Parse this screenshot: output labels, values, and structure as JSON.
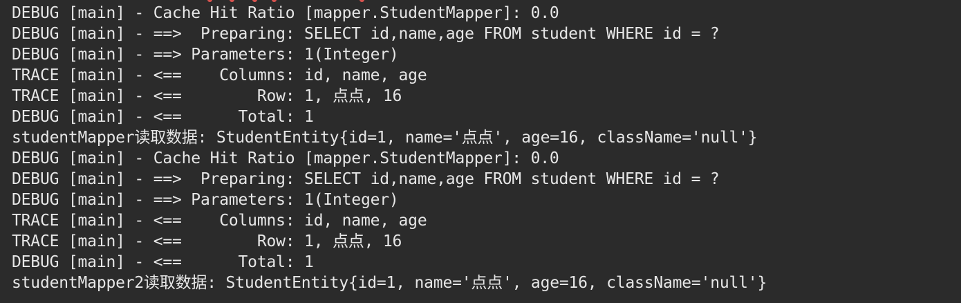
{
  "console": {
    "lines": [
      "DEBUG [main] - Cache Hit Ratio [mapper.StudentMapper]: 0.0",
      "DEBUG [main] - ==>  Preparing: SELECT id,name,age FROM student WHERE id = ?",
      "DEBUG [main] - ==> Parameters: 1(Integer)",
      "TRACE [main] - <==    Columns: id, name, age",
      "TRACE [main] - <==        Row: 1, 点点, 16",
      "DEBUG [main] - <==      Total: 1",
      "studentMapper读取数据: StudentEntity{id=1, name='点点', age=16, className='null'}",
      "DEBUG [main] - Cache Hit Ratio [mapper.StudentMapper]: 0.0",
      "DEBUG [main] - ==>  Preparing: SELECT id,name,age FROM student WHERE id = ?",
      "DEBUG [main] - ==> Parameters: 1(Integer)",
      "TRACE [main] - <==    Columns: id, name, age",
      "TRACE [main] - <==        Row: 1, 点点, 16",
      "DEBUG [main] - <==      Total: 1",
      "studentMapper2读取数据: StudentEntity{id=1, name='点点', age=16, className='null'}"
    ]
  },
  "colors": {
    "background": "#2b2b2b",
    "text": "#e6e6e6",
    "clipped_marks": "#d9534f"
  }
}
